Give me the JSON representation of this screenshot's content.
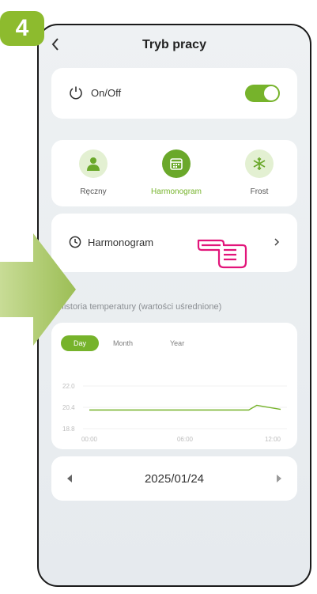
{
  "step": "4",
  "header": {
    "title": "Tryb pracy"
  },
  "power": {
    "label": "On/Off",
    "is_on": true
  },
  "modes": [
    {
      "label": "Ręczny",
      "icon": "person-icon",
      "active": false
    },
    {
      "label": "Harmonogram",
      "icon": "calendar-icon",
      "active": true
    },
    {
      "label": "Frost",
      "icon": "snowflake-icon",
      "active": false
    }
  ],
  "schedule": {
    "label": "Harmonogram"
  },
  "history": {
    "title": "Historia temperatury (wartości uśrednione)",
    "tabs": [
      "Day",
      "Month",
      "Year"
    ],
    "active_tab": "Day"
  },
  "chart_data": {
    "type": "line",
    "x": [
      "00:00",
      "06:00",
      "12:00"
    ],
    "y_ticks": [
      22.0,
      20.4,
      18.8
    ],
    "ylim": [
      18.8,
      22.0
    ],
    "series": [
      {
        "color": "#76b32b",
        "points": [
          [
            0,
            20.2
          ],
          [
            8,
            20.2
          ],
          [
            10,
            20.2
          ],
          [
            10.5,
            20.55
          ],
          [
            11,
            20.45
          ],
          [
            12,
            20.25
          ]
        ]
      }
    ],
    "xlim": [
      0,
      12
    ]
  },
  "date": {
    "value": "2025/01/24"
  },
  "colors": {
    "accent": "#76b32b",
    "badge": "#8dbb2e",
    "hand": "#e2157a",
    "arrow": "#a5c45e"
  }
}
